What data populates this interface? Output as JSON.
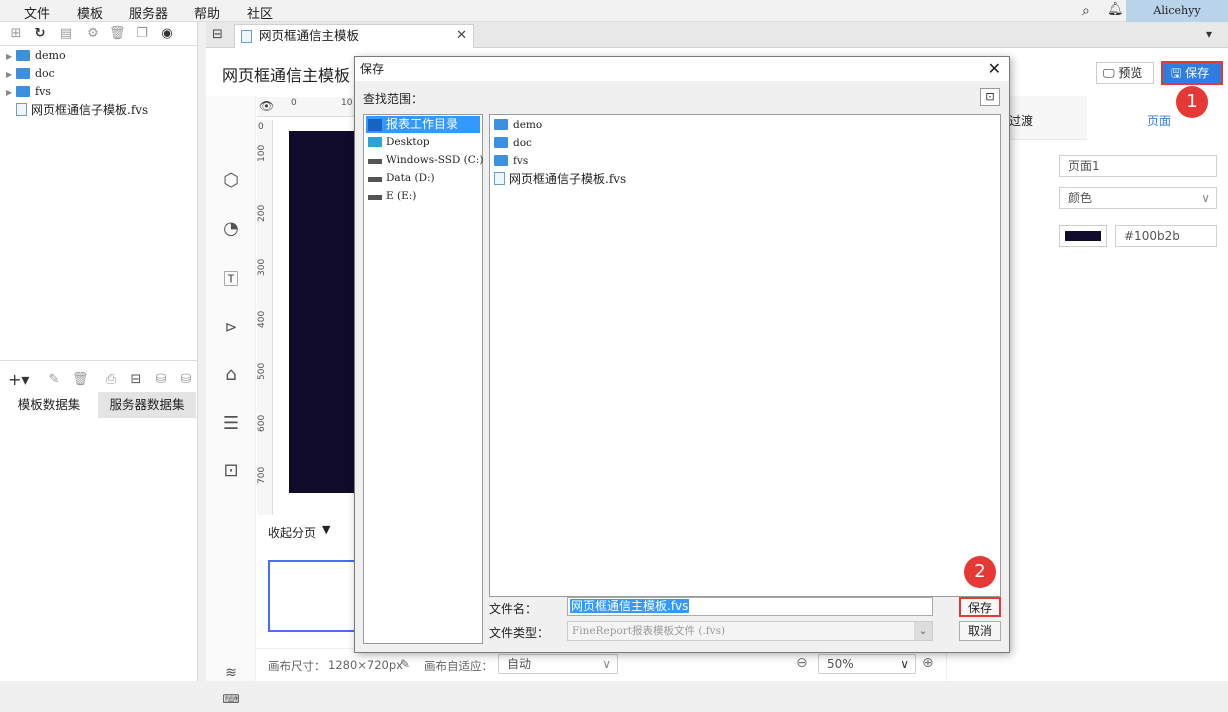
{
  "menubar": {
    "items": [
      "文件",
      "模板",
      "服务器",
      "帮助",
      "社区"
    ],
    "user": "Alicehyy"
  },
  "tree": {
    "items": [
      "demo",
      "doc",
      "fvs",
      "网页框通信子模板.fvs"
    ]
  },
  "datasets": {
    "tab1": "模板数据集",
    "tab2": "服务器数据集"
  },
  "main_tab": {
    "title": "网页框通信主模板"
  },
  "editor": {
    "title": "网页框通信主模板",
    "preview_label": "预览",
    "save_label": "保存",
    "ruler_h": [
      "0",
      "10"
    ],
    "ruler_v": [
      "0",
      "100",
      "200",
      "300",
      "400",
      "500",
      "600",
      "700"
    ],
    "collapse_label": "收起分页",
    "canvas_size_label": "画布尺寸：",
    "canvas_size_value": "1280×720px",
    "canvas_fit_label": "画布自适应：",
    "canvas_fit_value": "自动",
    "zoom_value": "50%"
  },
  "right_panel": {
    "tab1": "过渡",
    "tab2": "页面",
    "page_name": "页面1",
    "bg_type": "颜色",
    "bg_color_hex": "#100b2b"
  },
  "dialog": {
    "title": "保存",
    "lookin_label": "查找范围：",
    "locations": [
      "报表工作目录",
      "Desktop",
      "Windows-SSD (C:)",
      "Data (D:)",
      "E (E:)"
    ],
    "files": [
      "demo",
      "doc",
      "fvs",
      "网页框通信子模板.fvs"
    ],
    "filename_label": "文件名：",
    "filename_value": "网页框通信主模板.fvs",
    "filetype_label": "文件类型：",
    "filetype_value": "FineReport报表模板文件 (.fvs)",
    "save_button": "保存",
    "cancel_button": "取消"
  },
  "badges": {
    "one": "1",
    "two": "2"
  },
  "colors": {
    "accent": "#2f7de1",
    "highlight": "#e53935",
    "canvas": "#100b2b"
  }
}
